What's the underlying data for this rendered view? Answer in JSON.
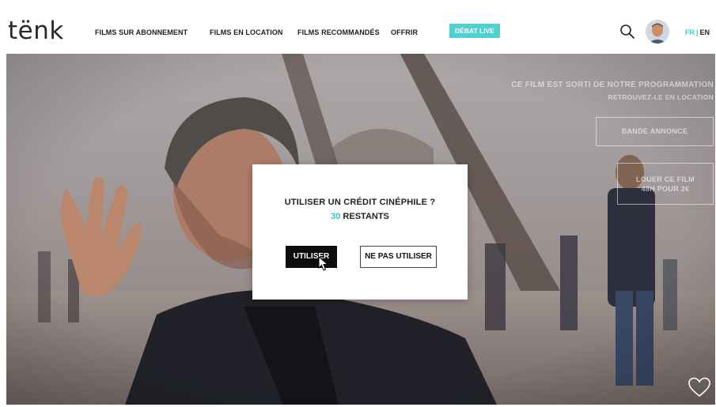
{
  "brand": {
    "logo": "tënk"
  },
  "nav": {
    "items": [
      {
        "label": "FILMS SUR ABONNEMENT"
      },
      {
        "label": "FILMS EN LOCATION"
      },
      {
        "label": "FILMS RECOMMANDÉS"
      },
      {
        "label": "OFFRIR"
      }
    ],
    "live_badge": "DÉBAT LIVE",
    "lang": {
      "fr": "FR",
      "sep": "|",
      "en": "EN"
    }
  },
  "hero": {
    "notice_line1": "CE FILM EST SORTI DE NOTRE PROGRAMMATION",
    "notice_line2": "RETROUVEZ-LE EN LOCATION",
    "trailer_button": "BANDE ANNONCE",
    "rent_button_line1": "LOUER CE FILM",
    "rent_button_line2": "48H POUR 2€"
  },
  "modal": {
    "question": "UTILISER UN CRÉDIT CINÉPHILE ?",
    "remaining_count": "30",
    "remaining_label": "RESTANTS",
    "use_button": "UTILISER",
    "dont_use_button": "NE PAS UTILISER"
  },
  "colors": {
    "accent": "#3ccaca",
    "live": "#4fd1d1",
    "button_dark": "#0d0d0d"
  },
  "icons": [
    "search-icon",
    "heart-icon",
    "cursor-icon"
  ]
}
